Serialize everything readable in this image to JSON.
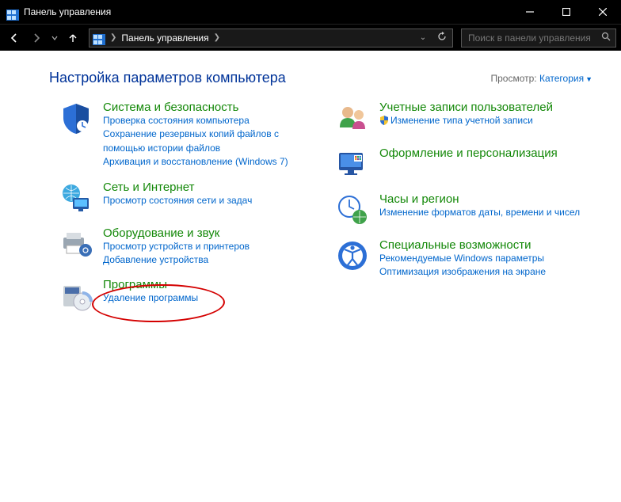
{
  "window": {
    "title": "Панель управления"
  },
  "addressbar": {
    "crumb_root": "Панель управления"
  },
  "search": {
    "placeholder": "Поиск в панели управления"
  },
  "header": {
    "title": "Настройка параметров компьютера",
    "view_label": "Просмотр:",
    "view_value": "Категория"
  },
  "left": [
    {
      "title": "Система и безопасность",
      "tasks": [
        "Проверка состояния компьютера",
        "Сохранение резервных копий файлов с помощью истории файлов",
        "Архивация и восстановление (Windows 7)"
      ]
    },
    {
      "title": "Сеть и Интернет",
      "tasks": [
        "Просмотр состояния сети и задач"
      ]
    },
    {
      "title": "Оборудование и звук",
      "tasks": [
        "Просмотр устройств и принтеров",
        "Добавление устройства"
      ]
    },
    {
      "title": "Программы",
      "tasks": [
        "Удаление программы"
      ]
    }
  ],
  "right": [
    {
      "title": "Учетные записи пользователей",
      "tasks": [
        "Изменение типа учетной записи"
      ],
      "shield": [
        true
      ]
    },
    {
      "title": "Оформление и персонализация",
      "tasks": []
    },
    {
      "title": "Часы и регион",
      "tasks": [
        "Изменение форматов даты, времени и чисел"
      ]
    },
    {
      "title": "Специальные возможности",
      "tasks": [
        "Рекомендуемые Windows параметры",
        "Оптимизация изображения на экране"
      ]
    }
  ]
}
